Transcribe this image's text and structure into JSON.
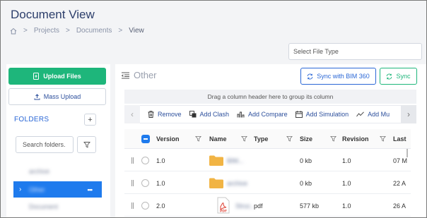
{
  "header": {
    "title": "Document View",
    "breadcrumb": [
      "Projects",
      "Documents",
      "View"
    ],
    "home_icon": "home-icon"
  },
  "file_type_filter": {
    "placeholder": "Select File Type"
  },
  "left_panel": {
    "upload_label": "Upload Files",
    "mass_upload_label": "Mass Upload",
    "folders_label": "FOLDERS",
    "add_folder_label": "+",
    "search_placeholder": "Search folders.",
    "tree_items": [
      {
        "label": "archive",
        "selected": false
      },
      {
        "label": "Other",
        "selected": true,
        "menu": "•••"
      },
      {
        "label": "Document",
        "selected": false
      }
    ]
  },
  "main": {
    "title": "Other",
    "sync_bim_label": "Sync with BIM 360",
    "sync_label": "Sync",
    "group_hint": "Drag a column header here to group its column",
    "toolbar": {
      "remove": "Remove",
      "add_clash": "Add Clash",
      "add_compare": "Add Compare",
      "add_simulation": "Add Simulation",
      "add_more": "Add Mu"
    },
    "columns": [
      "Version",
      "Name",
      "Type",
      "Size",
      "Revision",
      "Last"
    ],
    "rows": [
      {
        "version": "1.0",
        "name": "BIM...",
        "type": "",
        "size": "0 kb",
        "revision": "1.0",
        "last": "07 M",
        "icon": "folder-icon"
      },
      {
        "version": "1.0",
        "name": "archive",
        "type": "",
        "size": "0 kb",
        "revision": "1.0",
        "last": "22 A",
        "icon": "folder-icon"
      },
      {
        "version": "2.0",
        "name": "Struc...",
        "type": "pdf",
        "size": "577 kb",
        "revision": "1.0",
        "last": "26 A",
        "icon": "pdf-icon"
      }
    ]
  },
  "colors": {
    "primary": "#1f7bed",
    "success": "#1eb67b",
    "title": "#2c3e6b"
  }
}
